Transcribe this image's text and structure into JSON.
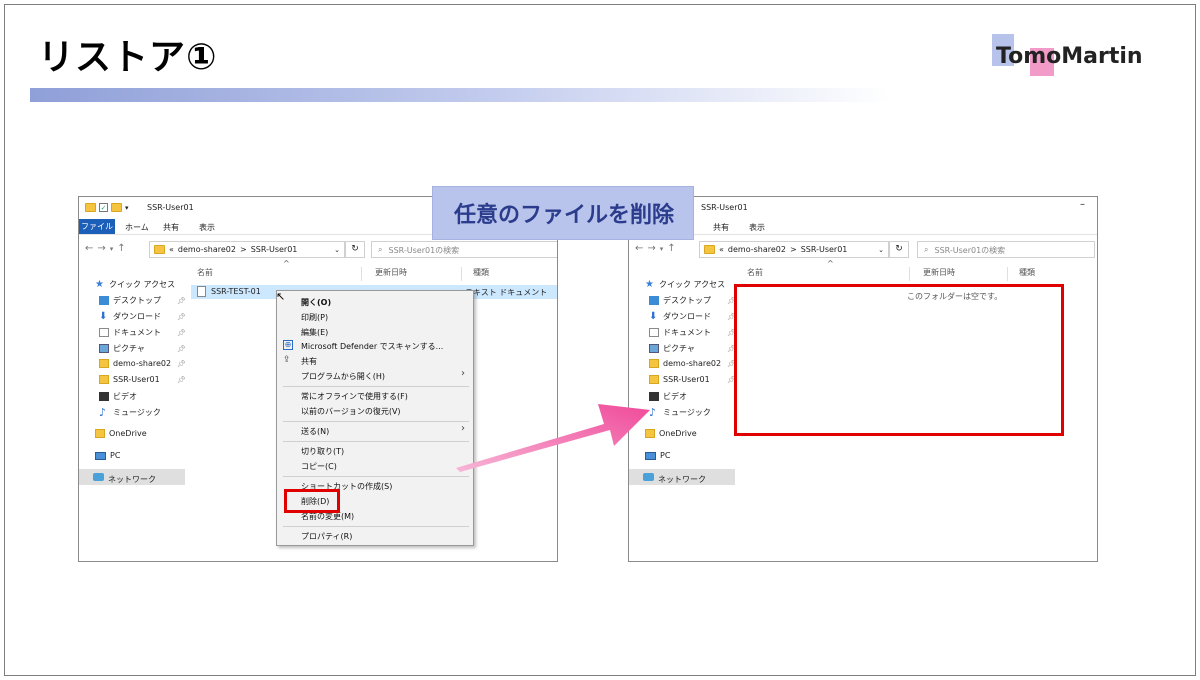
{
  "slide": {
    "title": "リストア①",
    "logo": "TomoMartin",
    "callout": "任意のファイルを削除"
  },
  "left_window": {
    "title": "SSR-User01",
    "ribbon": {
      "file": "ファイル",
      "home": "ホーム",
      "share": "共有",
      "view": "表示"
    },
    "address": {
      "prefix": "«",
      "crumb1": "demo-share02",
      "sep": ">",
      "crumb2": "SSR-User01",
      "refresh": "↻"
    },
    "search_placeholder": "SSR-User01の検索",
    "columns": {
      "name": "名前",
      "modified": "更新日時",
      "type": "種類"
    },
    "file": {
      "name": "SSR-TEST-01",
      "type": "テキスト ドキュメント"
    }
  },
  "right_window": {
    "title": "SSR-User01",
    "ribbon": {
      "share": "共有",
      "view": "表示"
    },
    "address": {
      "prefix": "«",
      "crumb1": "demo-share02",
      "sep": ">",
      "crumb2": "SSR-User01",
      "refresh": "↻"
    },
    "search_placeholder": "SSR-User01の検索",
    "columns": {
      "name": "名前",
      "modified": "更新日時",
      "type": "種類"
    },
    "empty_message": "このフォルダーは空です。"
  },
  "nav_pane": {
    "quick_access": "クイック アクセス",
    "desktop": "デスクトップ",
    "downloads": "ダウンロード",
    "documents": "ドキュメント",
    "pictures": "ピクチャ",
    "share": "demo-share02",
    "user": "SSR-User01",
    "videos": "ビデオ",
    "music": "ミュージック",
    "onedrive": "OneDrive",
    "pc": "PC",
    "network": "ネットワーク"
  },
  "context_menu": {
    "open": "開く(O)",
    "print": "印刷(P)",
    "edit": "編集(E)",
    "defender": "Microsoft Defender でスキャンする...",
    "share": "共有",
    "open_with": "プログラムから開く(H)",
    "offline": "常にオフラインで使用する(F)",
    "restore": "以前のバージョンの復元(V)",
    "send_to": "送る(N)",
    "cut": "切り取り(T)",
    "copy": "コピー(C)",
    "shortcut": "ショートカットの作成(S)",
    "delete": "削除(D)",
    "rename": "名前の変更(M)",
    "properties": "プロパティ(R)"
  },
  "colors": {
    "accent_red": "#e00000",
    "callout_bg": "#b9c4ec",
    "arrow_pink": "#f04a9a",
    "selection": "#cce8ff"
  }
}
